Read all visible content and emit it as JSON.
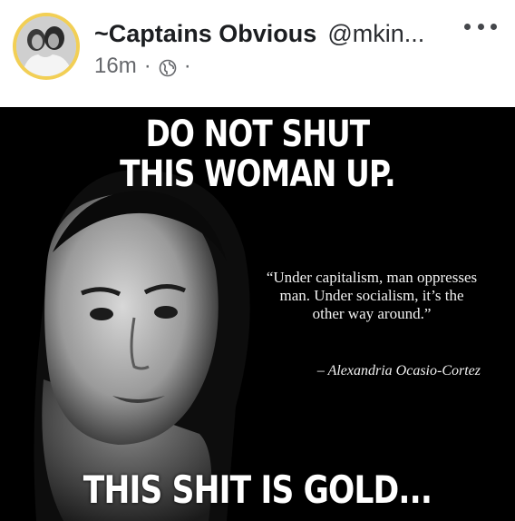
{
  "post": {
    "display_name": "~Captains Obvious",
    "handle": "@mkin...",
    "time": "16m",
    "separator": "·",
    "separator_after": "·",
    "privacy_icon": "globe-icon",
    "more_icon": "more-options-icon"
  },
  "meme": {
    "headline_line1": "DO NOT SHUT",
    "headline_line2": "THIS WOMAN UP.",
    "quote": "“Under capitalism, man oppresses man.  Under socialism, it’s the other way around.”",
    "attribution": "– Alexandria Ocasio-Cortez",
    "footer": "THIS SHIT IS GOLD..."
  },
  "colors": {
    "avatar_ring": "#f2cf55",
    "meme_background": "#000000",
    "text_primary": "#1c1e21",
    "text_secondary": "#65676b"
  }
}
